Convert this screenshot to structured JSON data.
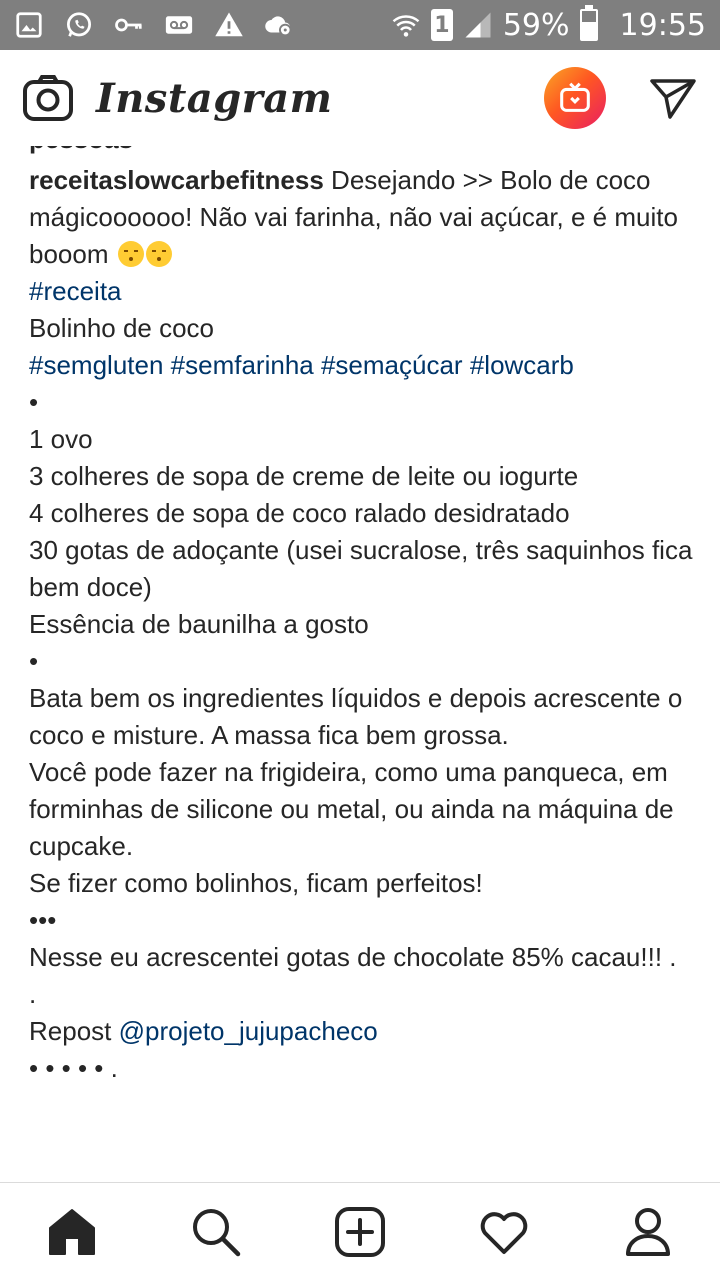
{
  "status_bar": {
    "sim_slot": "1",
    "battery": "59%",
    "battery_level": 0.59,
    "time": "19:55",
    "left_icons": [
      "image-icon",
      "whatsapp-icon",
      "key-icon",
      "voicemail-icon",
      "warning-icon",
      "cloud-settings-icon"
    ],
    "right_icons": [
      "wifi-icon",
      "signal-icon",
      "battery-icon"
    ]
  },
  "header": {
    "app_name": "Instagram"
  },
  "post": {
    "clipped_line": "pessoas",
    "username": "receitaslowcarbefitness",
    "caption_intro": " Desejando >> Bolo de coco mágicoooooo! Não vai farinha, não vai açúcar, e é muito booom ",
    "emojis": [
      "relieved-face",
      "relieved-face"
    ],
    "hashtag_recipe": "#receita",
    "line_bolinho": "Bolinho de coco",
    "hashtags": [
      "#semgluten",
      "#semfarinha",
      "#semaçúcar",
      "#lowcarb"
    ],
    "bullet_1": "•",
    "ingredients": [
      "1 ovo",
      "3 colheres de sopa de creme de leite ou iogurte",
      "4 colheres de sopa de coco ralado desidratado",
      "30 gotas de adoçante (usei sucralose, três saquinhos fica bem doce)",
      "Essência de baunilha a gosto"
    ],
    "bullet_2": "•",
    "instructions": [
      "Bata bem os ingredientes líquidos e depois acrescente o coco e misture. A massa fica bem grossa.",
      "Você pode fazer na frigideira, como uma panqueca, em forminhas de silicone ou metal, ou ainda na máquina de cupcake.",
      "Se fizer como bolinhos, ficam perfeitos!"
    ],
    "bullet_3": "•••",
    "chocolate_note": "Nesse eu acrescentei gotas de chocolate 85% cacau!!! .",
    "dot_line": ".",
    "repost_label": "Repost ",
    "repost_mention": "@projeto_jujupacheco",
    "ending_dots": "• • • • • ."
  },
  "nav": {
    "items": [
      "home-icon",
      "search-icon",
      "new-post-icon",
      "activity-heart-icon",
      "profile-icon"
    ]
  },
  "colors": {
    "status_bar_bg": "#7f7f7f",
    "text": "#262626",
    "hashtag_link": "#003569",
    "divider": "#dbdbdb"
  }
}
